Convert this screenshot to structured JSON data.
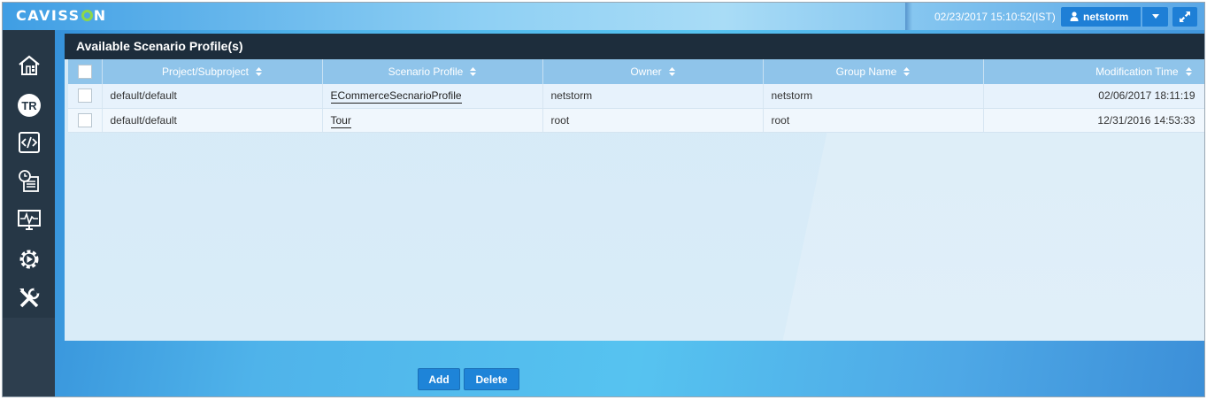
{
  "app": {
    "logo": "CAVISSON",
    "datetime": "02/23/2017 15:10:52(IST)",
    "user": "netstorm"
  },
  "panel": {
    "title": "Available Scenario Profile(s)"
  },
  "table": {
    "columns": [
      "Project/Subproject",
      "Scenario Profile",
      "Owner",
      "Group Name",
      "Modification Time"
    ],
    "rows": [
      {
        "project": "default/default",
        "profile": "ECommerceSecnarioProfile",
        "owner": "netstorm",
        "group": "netstorm",
        "mtime": "02/06/2017 18:11:19"
      },
      {
        "project": "default/default",
        "profile": "Tour",
        "owner": "root",
        "group": "root",
        "mtime": "12/31/2016 14:53:33"
      }
    ]
  },
  "actions": {
    "add": "Add",
    "delete": "Delete"
  },
  "sidebar": {
    "icons": [
      "home-icon",
      "tr-icon",
      "code-icon",
      "scenario-clock-icon",
      "monitor-icon",
      "settings-play-icon",
      "tools-icon"
    ]
  }
}
